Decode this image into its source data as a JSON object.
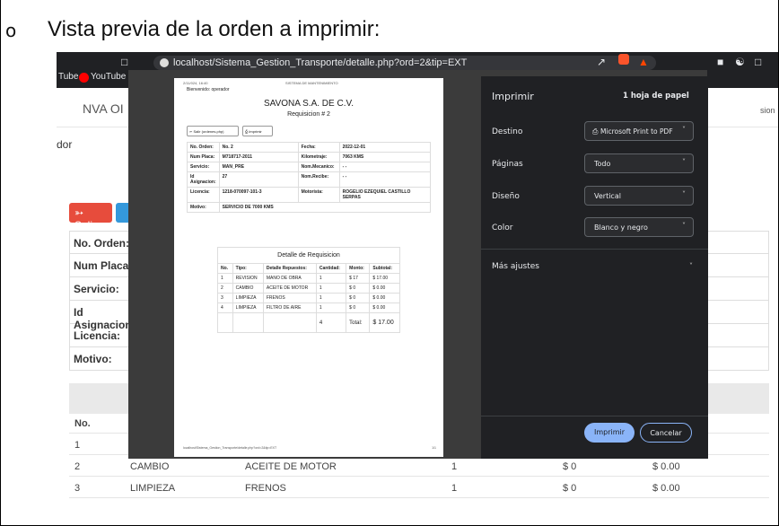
{
  "doc": {
    "bullet": "o",
    "heading": "Vista previa de la orden a imprimir:"
  },
  "browser": {
    "url": "localhost/Sistema_Gestion_Transporte/detalle.php?ord=2&tip=EXT",
    "bookmark1": "Tube",
    "bookmark2": "YouTube M"
  },
  "page": {
    "nav_item": "NVA OI",
    "nav_right": "sion",
    "left_label": "dor",
    "salir": "Salir",
    "labels": [
      "No. Orden:",
      "Num Placa:",
      "Servicio:",
      "Id Asignacion:",
      "Licencia:",
      "Motivo:"
    ],
    "no_header": "No.",
    "rows": [
      {
        "no": "1",
        "tipo": "",
        "detalle": "",
        "cant": "",
        "monto": "",
        "sub": ""
      },
      {
        "no": "2",
        "tipo": "CAMBIO",
        "detalle": "ACEITE DE MOTOR",
        "cant": "1",
        "monto": "$ 0",
        "sub": "$ 0.00"
      },
      {
        "no": "3",
        "tipo": "LIMPIEZA",
        "detalle": "FRENOS",
        "cant": "1",
        "monto": "$ 0",
        "sub": "$ 0.00"
      }
    ]
  },
  "preview": {
    "top_left": "2/11/024, 16:40",
    "top_center": "SISTEMA DE MANTENIMIENTO",
    "bienvenido": "Bienvenido: operador",
    "company": "SAVONA S.A. DE C.V.",
    "requisicion": "Requisicion # 2",
    "btn_salir": "Salir (ordenes.php)",
    "btn_imprimir": "Imprimir",
    "info": [
      {
        "l1": "No. Orden:",
        "v1": "No. 2",
        "l2": "Fecha:",
        "v2": "2022-12-01"
      },
      {
        "l1": "Num Placa:",
        "v1": "M718717-2011",
        "l2": "Kilometraje:",
        "v2": "7063 KMS"
      },
      {
        "l1": "Servicio:",
        "v1": "MAN_PRE",
        "l2": "Nom.Mecanico:",
        "v2": "- -"
      },
      {
        "l1": "Id Asignacion:",
        "v1": "27",
        "l2": "Nom.Recibe:",
        "v2": "- -"
      },
      {
        "l1": "Licencia:",
        "v1": "1218-070097-101-3",
        "l2": "Motorista:",
        "v2": "ROGELIO EZEQUIEL CASTILLO SERPAS"
      }
    ],
    "motivo_label": "Motivo:",
    "motivo_value": "SERVICIO DE 7000 KMS",
    "detalle_title": "Detalle de Requisicion",
    "det_headers": [
      "No.",
      "Tipo:",
      "Detalle Repuestos:",
      "Cantidad:",
      "Monto:",
      "Subtotal:"
    ],
    "det_rows": [
      [
        "1",
        "REVISION",
        "MANO DE OBRA",
        "1",
        "$ 17",
        "$ 17.00"
      ],
      [
        "2",
        "CAMBIO",
        "ACEITE DE MOTOR",
        "1",
        "$ 0",
        "$ 0.00"
      ],
      [
        "3",
        "LIMPIEZA",
        "FRENOS",
        "1",
        "$ 0",
        "$ 0.00"
      ],
      [
        "4",
        "LIMPIEZA",
        "FILTRO DE AIRE",
        "1",
        "$ 0",
        "$ 0.00"
      ]
    ],
    "total_qty": "4",
    "total_label": "Total:",
    "total_value": "$ 17.00",
    "footer_url": "localhost/Sistema_Gestion_Transporte/detalle.php?ord=2&tip=EXT",
    "footer_page": "1/1"
  },
  "print_panel": {
    "title": "Imprimir",
    "sheets": "1 hoja de papel",
    "destino_label": "Destino",
    "destino_value": "Microsoft Print to PDF",
    "paginas_label": "Páginas",
    "paginas_value": "Todo",
    "diseno_label": "Diseño",
    "diseno_value": "Vertical",
    "color_label": "Color",
    "color_value": "Blanco y negro",
    "mas_label": "Más ajustes",
    "print_button": "Imprimir",
    "cancel_button": "Cancelar"
  }
}
